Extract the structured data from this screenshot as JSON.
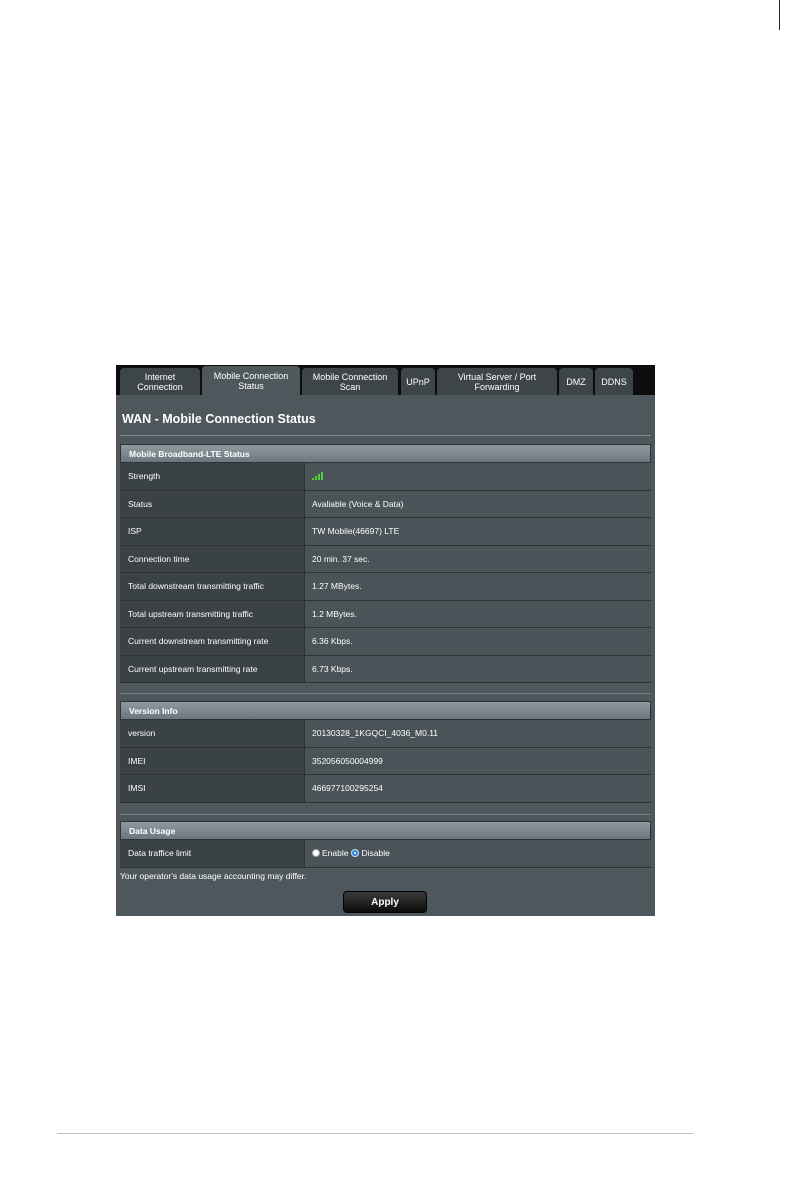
{
  "tabs": [
    {
      "label": "Internet Connection"
    },
    {
      "label": "Mobile Connection Status",
      "active": true
    },
    {
      "label": "Mobile Connection Scan"
    },
    {
      "label": "UPnP"
    },
    {
      "label": "Virtual Server / Port Forwarding"
    },
    {
      "label": "DMZ"
    },
    {
      "label": "DDNS"
    }
  ],
  "page_title": "WAN - Mobile Connection Status",
  "lte_status": {
    "header": "Mobile Broadband-LTE Status",
    "rows": [
      {
        "label": "Strength",
        "value": "",
        "signal_bars": 4
      },
      {
        "label": "Status",
        "value": "Avaliable (Voice & Data)"
      },
      {
        "label": "ISP",
        "value": "TW Mobile(46697) LTE"
      },
      {
        "label": "Connection time",
        "value": "20 min. 37 sec."
      },
      {
        "label": "Total downstream transmitting traffic",
        "value": "1.27 MBytes."
      },
      {
        "label": "Total upstream transmitting traffic",
        "value": "1.2 MBytes."
      },
      {
        "label": "Current downstream transmitting rate",
        "value": "6.36 Kbps."
      },
      {
        "label": "Current upstream transmitting rate",
        "value": "6.73 Kbps."
      }
    ]
  },
  "version_info": {
    "header": "Version Info",
    "rows": [
      {
        "label": "version",
        "value": "20130328_1KGQCI_4036_M0.11"
      },
      {
        "label": "IMEI",
        "value": "352056050004999"
      },
      {
        "label": "IMSI",
        "value": "466977100295254"
      }
    ]
  },
  "data_usage": {
    "header": "Data Usage",
    "limit_label": "Data traffice limit",
    "options": [
      {
        "label": "Enable",
        "selected": false
      },
      {
        "label": "Disable",
        "selected": true
      }
    ],
    "note": "Your operator's data usage accounting may differ."
  },
  "apply_label": "Apply",
  "colors": {
    "panel_bg": "#4e575c",
    "tab_bar": "#0d0d0d",
    "signal_green": "#4cd137",
    "radio_selected": "#2f7fd9"
  }
}
